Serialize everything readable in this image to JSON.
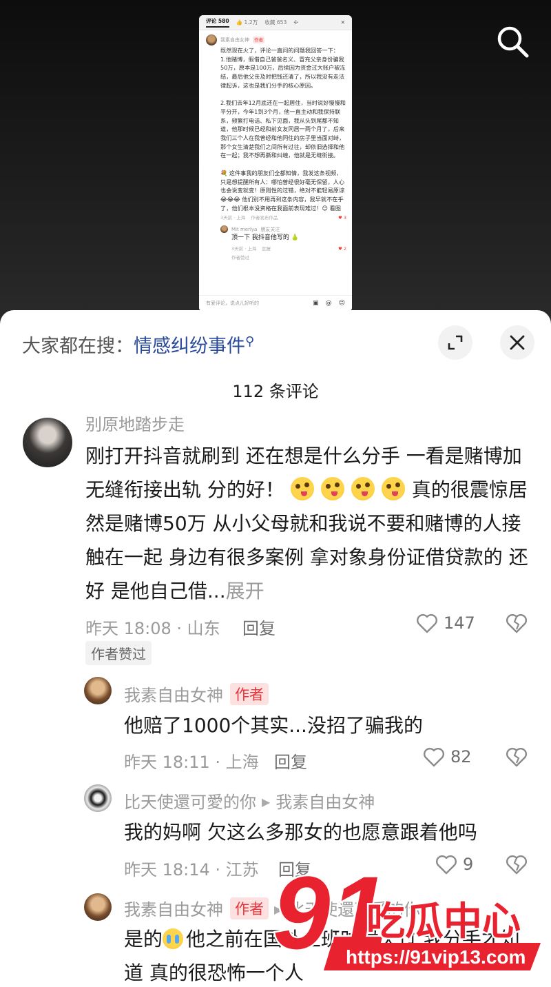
{
  "video_preview": {
    "tabs": [
      "评论 580",
      "👍 1.2万",
      "收藏 653"
    ],
    "post_author": "我素自由女神",
    "post_author_tag": "作者",
    "post_text": "既然现在火了，评论一直问的问题我回答一下：\n1.他赌博，假借自己爸爸名义、冒充父亲身份骗我50万，原本是100万，后续因为资金过大账户被冻结，最后他父亲及时把钱还清了，所以我没有走法律起诉，这也是我们分手的核心原因。\n\n2.我们去年12月底还在一起居住，当时说好慢慢和平分开，今年1到3个月，他一直主动和我保持联系，频繁打电话、私下见面，我从头到尾都不知道，他那时候已经和前女友同居一两个月了，后来我们三个人在我曾经和他同住的房子里当面对峙，那个女生清楚我们之间所有过往，却依旧选择和他在一起；我不想再撕和纠缠，他就是无缝衔接。\n\n💐 这件事我的朋友们全都知情，我发这条视频，只是想提醒所有人：哪怕曾经很好毫无保留，人心也会说变就变！原则性的过错，绝对不能轻易原谅 😂😂😂 他们别不用再到这条内容，我早就不在乎了，他们根本没资格在我面前表现难过！😊 看图",
    "post_meta": [
      "3天前 · 上海",
      "作者发布作品"
    ],
    "post_likes": "3",
    "reply_name": "Mit merlya",
    "reply_tag": "朋友关注",
    "reply_text": "顶一下 我抖音他写的 🍐",
    "reply_meta": [
      "3天前 · 上海",
      "回复"
    ],
    "reply_likes": "2",
    "reply_badge": "作者赞过",
    "input_placeholder": "有爱评论，说点儿好听的"
  },
  "sheet": {
    "hot_search_prefix": "大家都在搜：",
    "hot_search_keyword": "情感纠纷事件",
    "comment_count": "112 条评论"
  },
  "comments": [
    {
      "name": "别原地踏步走",
      "text_a": "刚打开抖音就刷到 还在想是什么分手 一看是赌博加无缝衔接出轨 分的好！",
      "text_b": "真的很震惊居然是赌博50万 从小父母就和我说不要和赌博的人接触在一起 身边有很多案例 拿对象身份证借贷款的 还好 是他自己借...",
      "more": "展开",
      "time": "昨天 18:08 · 山东",
      "reply": "回复",
      "likes": "147",
      "badge": "作者赞过"
    },
    {
      "name": "我素自由女神",
      "tag": "作者",
      "text": "他赔了1000个其实...没招了骗我的",
      "time": "昨天 18:11 · 上海",
      "reply": "回复",
      "likes": "82"
    },
    {
      "name": "比天使還可愛的你",
      "reply_to": "我素自由女神",
      "text": "我的妈啊 欠这么多那女的也愿意跟着他吗",
      "time": "昨天 18:14 · 江苏",
      "reply": "回复",
      "likes": "9"
    },
    {
      "name": "我素自由女神",
      "tag": "作者",
      "reply_to": "比天使還可愛的你",
      "text_a": "是的",
      "text_b": "他之前在国外上班时候欠过 我分手才知道 真的很恐怖一个人"
    }
  ],
  "watermark": {
    "number": "91",
    "title": "吃瓜中心",
    "url": "https://91vip13.com"
  },
  "colors": {
    "keyword": "#2a4a9b",
    "author_tag_bg": "#fde1e1",
    "author_tag_text": "#e5353a",
    "watermark_red": "#e8222e"
  }
}
